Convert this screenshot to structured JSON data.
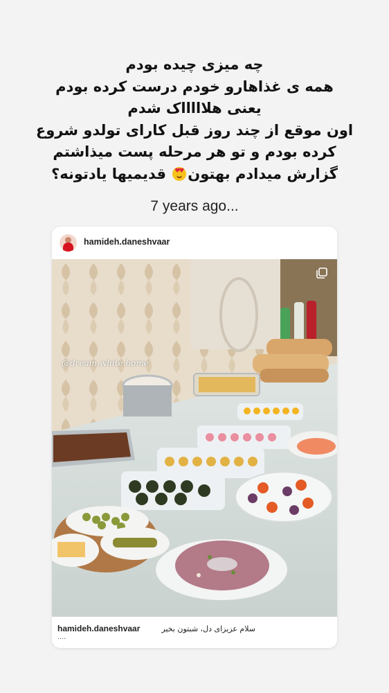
{
  "story": {
    "lines": [
      "چه میزی چیده بودم",
      "همه ی غذاهارو خودم درست کرده بودم",
      "یعنی هلاااااک شدم",
      "اون موقع از چند روز قبل کارای تولدو شروع",
      "کرده بودم و تو هر مرحله پست میذاشتم",
      "گزارش میدادم بهتون",
      "قدیمیها یادتونه؟"
    ],
    "emoji": "heart-eyes-emoji",
    "years_ago": "7 years ago..."
  },
  "post": {
    "username": "hamideh.daneshvaar",
    "watermark": "@dream.white.home",
    "multi_icon": "carousel-icon",
    "caption": {
      "username": "hamideh.daneshvaar",
      "text": "سلام عزیزای دل، شبتون بخیر",
      "more": "...."
    }
  },
  "colors": {
    "background": "#f3f3f3",
    "card": "#ffffff",
    "text": "#111111"
  }
}
